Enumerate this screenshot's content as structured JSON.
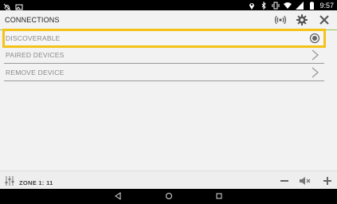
{
  "status_bar": {
    "time": "9:57",
    "icons": [
      "notification-off-icon",
      "image-icon",
      "location-icon",
      "bluetooth-icon",
      "vibrate-icon",
      "wifi-icon",
      "signal-icon",
      "battery-icon"
    ]
  },
  "header": {
    "title": "CONNECTIONS",
    "icons": [
      "broadcast-icon",
      "gear-icon",
      "close-icon"
    ]
  },
  "menu": {
    "items": [
      {
        "label": "DISCOVERABLE",
        "trailing_icon": "radio-selected-icon",
        "selected": true
      },
      {
        "label": "PAIRED DEVICES",
        "trailing_icon": "chevron-right-icon"
      },
      {
        "label": "REMOVE DEVICE",
        "trailing_icon": "chevron-right-icon"
      }
    ]
  },
  "footer": {
    "zone_label": "ZONE 1: 11",
    "icons": [
      "equalizer-icon",
      "minus-icon",
      "mute-icon",
      "plus-icon"
    ]
  },
  "nav_bar": {
    "icons": [
      "back-icon",
      "home-icon",
      "recents-icon"
    ]
  },
  "colors": {
    "highlight": "#f5c218",
    "header_accent": "#8fc44a",
    "background": "#f2f2f2"
  }
}
